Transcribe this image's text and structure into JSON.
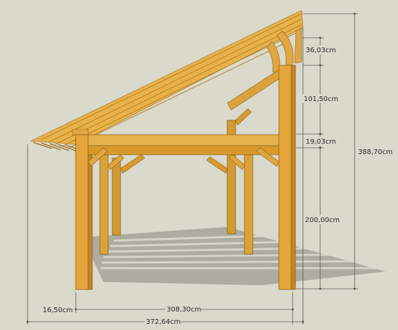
{
  "scene": {
    "background": "#d9d9cc",
    "wood_light": "#e8b24a",
    "wood_mid": "#d99a2b",
    "wood_dark": "#b9781a",
    "shadow": "#9e9e93",
    "line_color": "#6b6b66"
  },
  "dimensions": {
    "roof_thickness": "36,03cm",
    "upper_height": "101,50cm",
    "beam_height": "19,03cm",
    "post_height": "200,00cm",
    "total_height": "388,70cm",
    "overhang": "16,50cm",
    "span": "308,30cm",
    "total_width": "372,64cm"
  }
}
